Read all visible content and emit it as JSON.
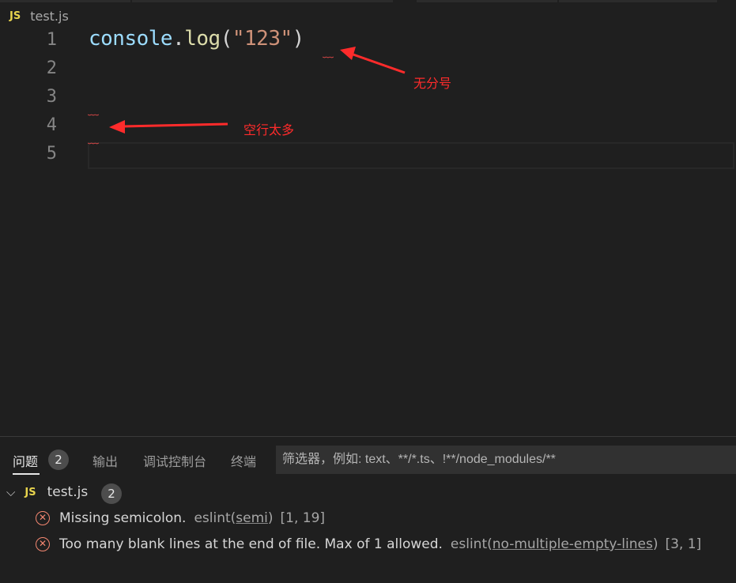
{
  "breadcrumb": {
    "lang_badge": "JS",
    "file": "test.js"
  },
  "editor": {
    "line_numbers": [
      "1",
      "2",
      "3",
      "4",
      "5"
    ],
    "code": {
      "obj": "console",
      "dot": ".",
      "fn": "log",
      "open": "(",
      "str": "\"123\"",
      "close": ")"
    }
  },
  "annotations": {
    "no_semicolon": "无分号",
    "too_many_blank_lines": "空行太多",
    "arrow_color": "#ff2b2b"
  },
  "panel": {
    "tabs": [
      {
        "label": "问题",
        "badge": "2"
      },
      {
        "label": "输出"
      },
      {
        "label": "调试控制台"
      },
      {
        "label": "终端"
      }
    ],
    "filter_placeholder": "筛选器，例如: text、**/*.ts、!**/node_modules/**",
    "file_group": {
      "lang_badge": "JS",
      "file": "test.js",
      "count": "2"
    },
    "problems": [
      {
        "message": "Missing semicolon.",
        "source": "eslint(",
        "rule": "semi",
        "source_end": ")",
        "position": "[1, 19]"
      },
      {
        "message": "Too many blank lines at the end of file. Max of 1 allowed.",
        "source": "eslint(",
        "rule": "no-multiple-empty-lines",
        "source_end": ")",
        "position": "[3, 1]"
      }
    ]
  },
  "colors": {
    "error": "#f48771",
    "js_badge": "#e8d44d",
    "string": "#ce9178",
    "function": "#dcdcaa",
    "object": "#9cdcfe"
  }
}
